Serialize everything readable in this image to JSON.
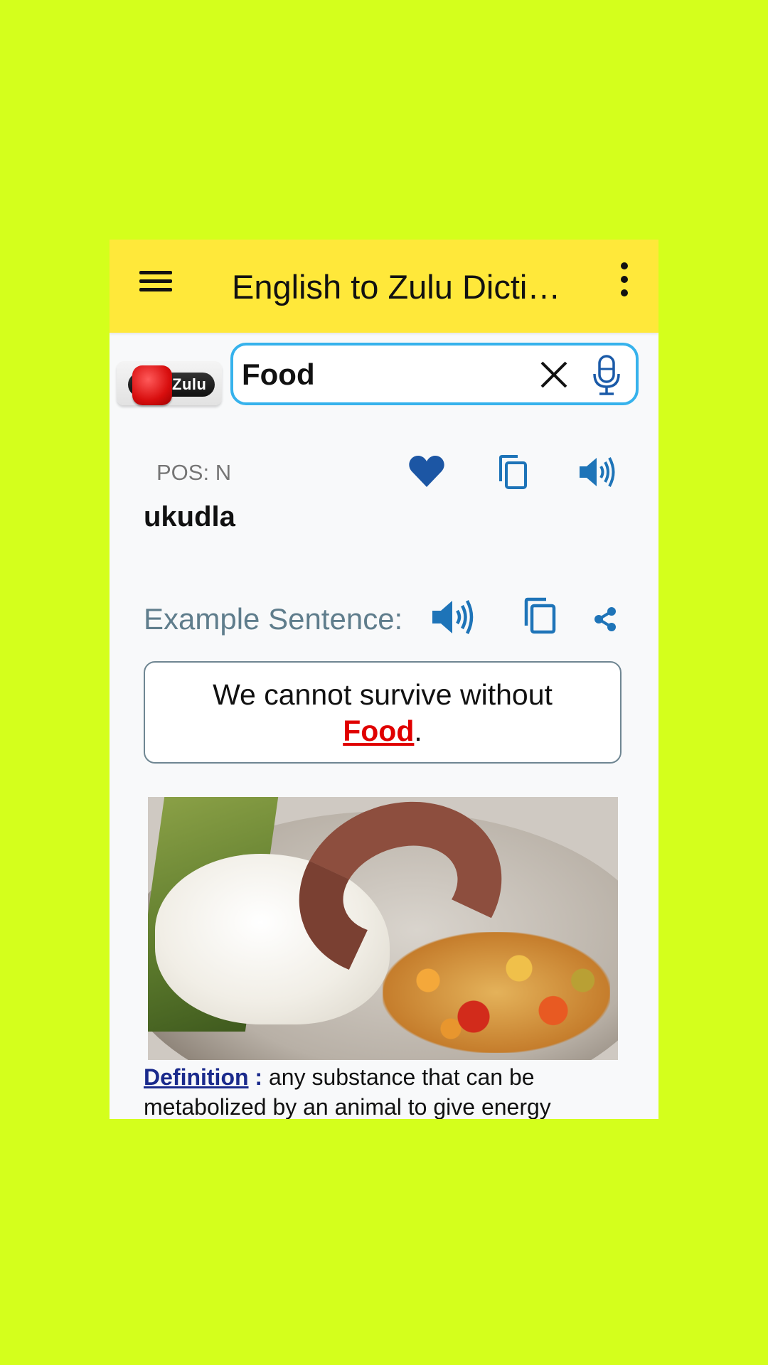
{
  "colors": {
    "page_background": "#d4ff1c",
    "app_bar": "#ffe83a",
    "accent_blue": "#1a5aa8",
    "search_border": "#36b2ec",
    "highlight_red": "#e00000",
    "definition_label": "#1a2a8c"
  },
  "app_bar": {
    "menu_icon": "hamburger-menu-icon",
    "title": "English to Zulu Dicti…",
    "overflow_icon": "more-vertical-icon"
  },
  "search": {
    "language_badge": "Zulu",
    "value": "Food",
    "placeholder": "",
    "clear_icon": "close-icon",
    "voice_icon": "microphone-icon"
  },
  "entry": {
    "pos": "POS: N",
    "translation": "ukudla",
    "actions": [
      {
        "name": "favorite",
        "icon": "heart-icon"
      },
      {
        "name": "copy",
        "icon": "copy-icon"
      },
      {
        "name": "speak",
        "icon": "volume-icon"
      }
    ]
  },
  "example": {
    "label": "Example Sentence:",
    "sentence_before": "We cannot survive without",
    "highlight_word": "Food",
    "sentence_after": ".",
    "actions": [
      {
        "name": "speak",
        "icon": "volume-icon"
      },
      {
        "name": "copy",
        "icon": "copy-icon"
      },
      {
        "name": "share",
        "icon": "share-icon"
      }
    ]
  },
  "image": {
    "alt": "Plate of pap with boerewors sausage and chakalaka relish"
  },
  "definition": {
    "label": "Definition",
    "separator": " :",
    "text": " any substance that can be metabolized by an animal to give energy"
  }
}
